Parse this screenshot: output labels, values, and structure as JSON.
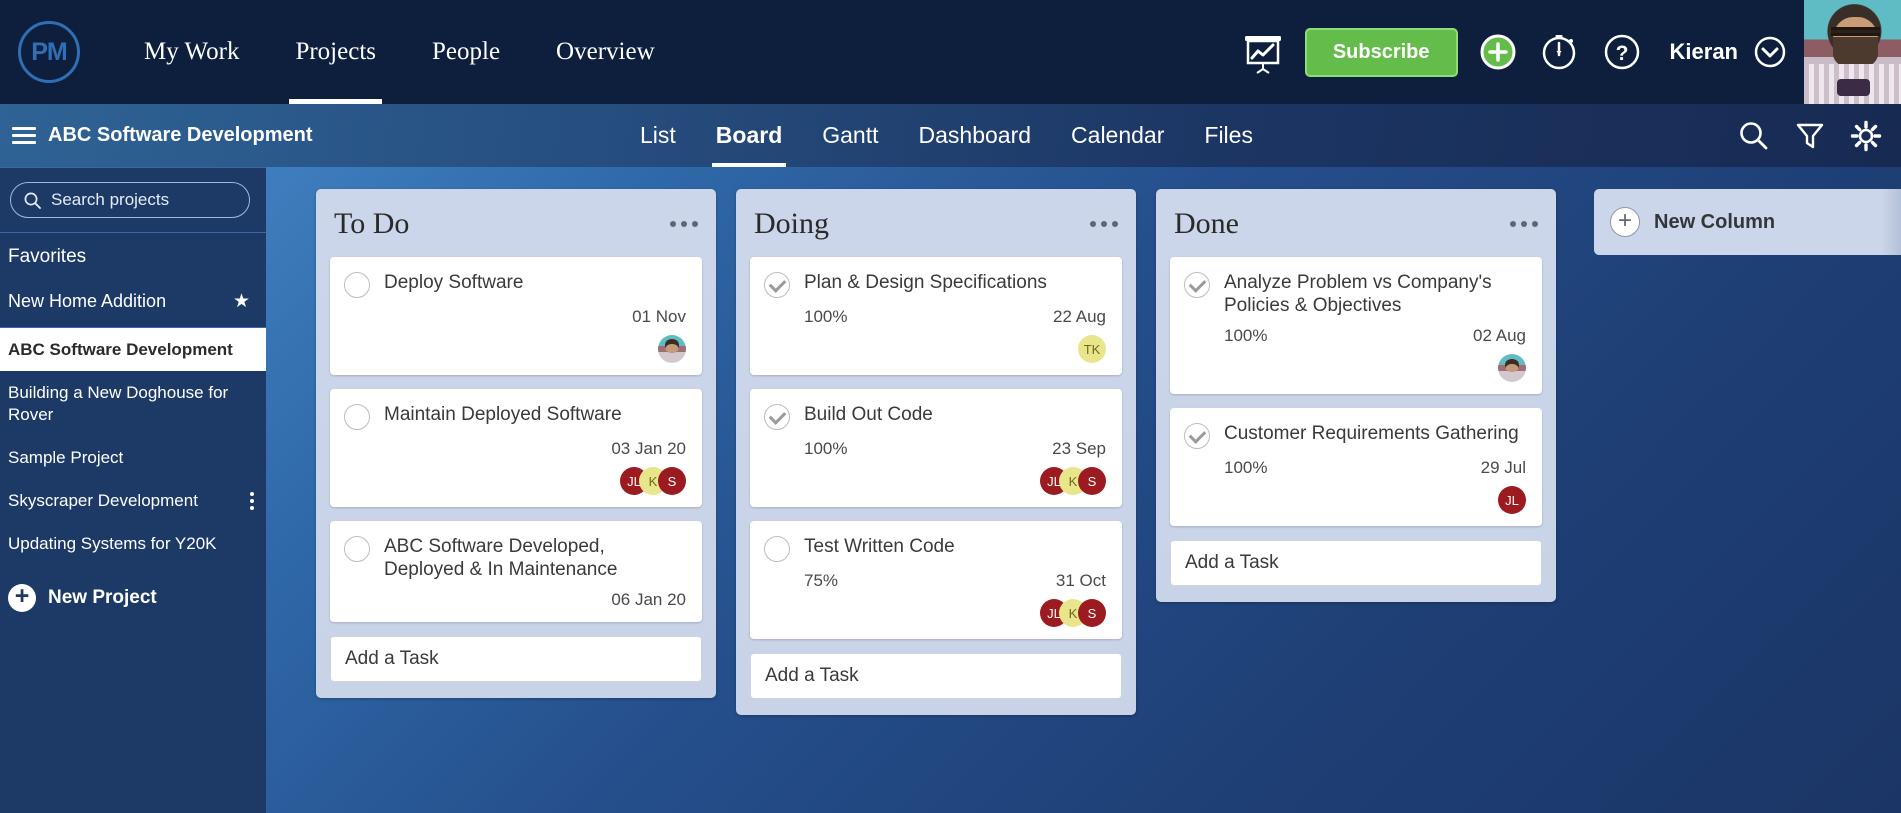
{
  "header": {
    "logo_text": "PM",
    "nav": [
      {
        "label": "My Work",
        "active": false
      },
      {
        "label": "Projects",
        "active": true
      },
      {
        "label": "People",
        "active": false
      },
      {
        "label": "Overview",
        "active": false
      }
    ],
    "subscribe_label": "Subscribe",
    "username": "Kieran",
    "accent_green": "#64bd4b",
    "bar_color": "#0e1f3d"
  },
  "subnav": {
    "project_title": "ABC Software Development",
    "tabs": [
      {
        "label": "List",
        "active": false
      },
      {
        "label": "Board",
        "active": true
      },
      {
        "label": "Gantt",
        "active": false
      },
      {
        "label": "Dashboard",
        "active": false
      },
      {
        "label": "Calendar",
        "active": false
      },
      {
        "label": "Files",
        "active": false
      }
    ]
  },
  "sidebar": {
    "search_placeholder": "Search projects",
    "favorites_label": "Favorites",
    "favorite_project": "New Home Addition",
    "projects": [
      {
        "label": "ABC Software Development",
        "active": true,
        "menu": false
      },
      {
        "label": "Building a New Doghouse for Rover",
        "active": false,
        "menu": false
      },
      {
        "label": "Sample Project",
        "active": false,
        "menu": false
      },
      {
        "label": "Skyscraper Development",
        "active": false,
        "menu": true
      },
      {
        "label": "Updating Systems for Y20K",
        "active": false,
        "menu": false
      }
    ],
    "new_project_label": "New Project"
  },
  "board": {
    "add_task_label": "Add a Task",
    "new_column_label": "New Column",
    "columns": [
      {
        "title": "To Do",
        "cards": [
          {
            "title": "Deploy Software",
            "done": false,
            "percent": "",
            "due": "01 Nov",
            "avatars": [
              {
                "initials": "",
                "type": "photo",
                "color": ""
              }
            ]
          },
          {
            "title": "Maintain Deployed Software",
            "done": false,
            "percent": "",
            "due": "03 Jan 20",
            "avatars": [
              {
                "initials": "JL",
                "type": "initials",
                "color": "#9c1b21"
              },
              {
                "initials": "K",
                "type": "initials",
                "color": "#e8e58a"
              },
              {
                "initials": "S",
                "type": "initials",
                "color": "#9c1b21"
              }
            ]
          },
          {
            "title": "ABC Software Developed, Deployed & In Maintenance",
            "done": false,
            "percent": "",
            "due": "06 Jan 20",
            "avatars": []
          }
        ]
      },
      {
        "title": "Doing",
        "cards": [
          {
            "title": "Plan & Design Specifications",
            "done": true,
            "percent": "100%",
            "due": "22 Aug",
            "avatars": [
              {
                "initials": "TK",
                "type": "initials",
                "color": "#e8e58a"
              }
            ]
          },
          {
            "title": "Build Out Code",
            "done": true,
            "percent": "100%",
            "due": "23 Sep",
            "avatars": [
              {
                "initials": "JL",
                "type": "initials",
                "color": "#9c1b21"
              },
              {
                "initials": "K",
                "type": "initials",
                "color": "#e8e58a"
              },
              {
                "initials": "S",
                "type": "initials",
                "color": "#9c1b21"
              }
            ]
          },
          {
            "title": "Test Written Code",
            "done": false,
            "percent": "75%",
            "due": "31 Oct",
            "avatars": [
              {
                "initials": "JL",
                "type": "initials",
                "color": "#9c1b21"
              },
              {
                "initials": "K",
                "type": "initials",
                "color": "#e8e58a"
              },
              {
                "initials": "S",
                "type": "initials",
                "color": "#9c1b21"
              }
            ]
          }
        ]
      },
      {
        "title": "Done",
        "cards": [
          {
            "title": "Analyze Problem vs Company's Policies & Objectives",
            "done": true,
            "percent": "100%",
            "due": "02 Aug",
            "avatars": [
              {
                "initials": "",
                "type": "photo",
                "color": ""
              }
            ]
          },
          {
            "title": "Customer Requirements Gathering",
            "done": true,
            "percent": "100%",
            "due": "29 Jul",
            "avatars": [
              {
                "initials": "JL",
                "type": "initials",
                "color": "#9c1b21"
              }
            ]
          }
        ]
      }
    ]
  }
}
